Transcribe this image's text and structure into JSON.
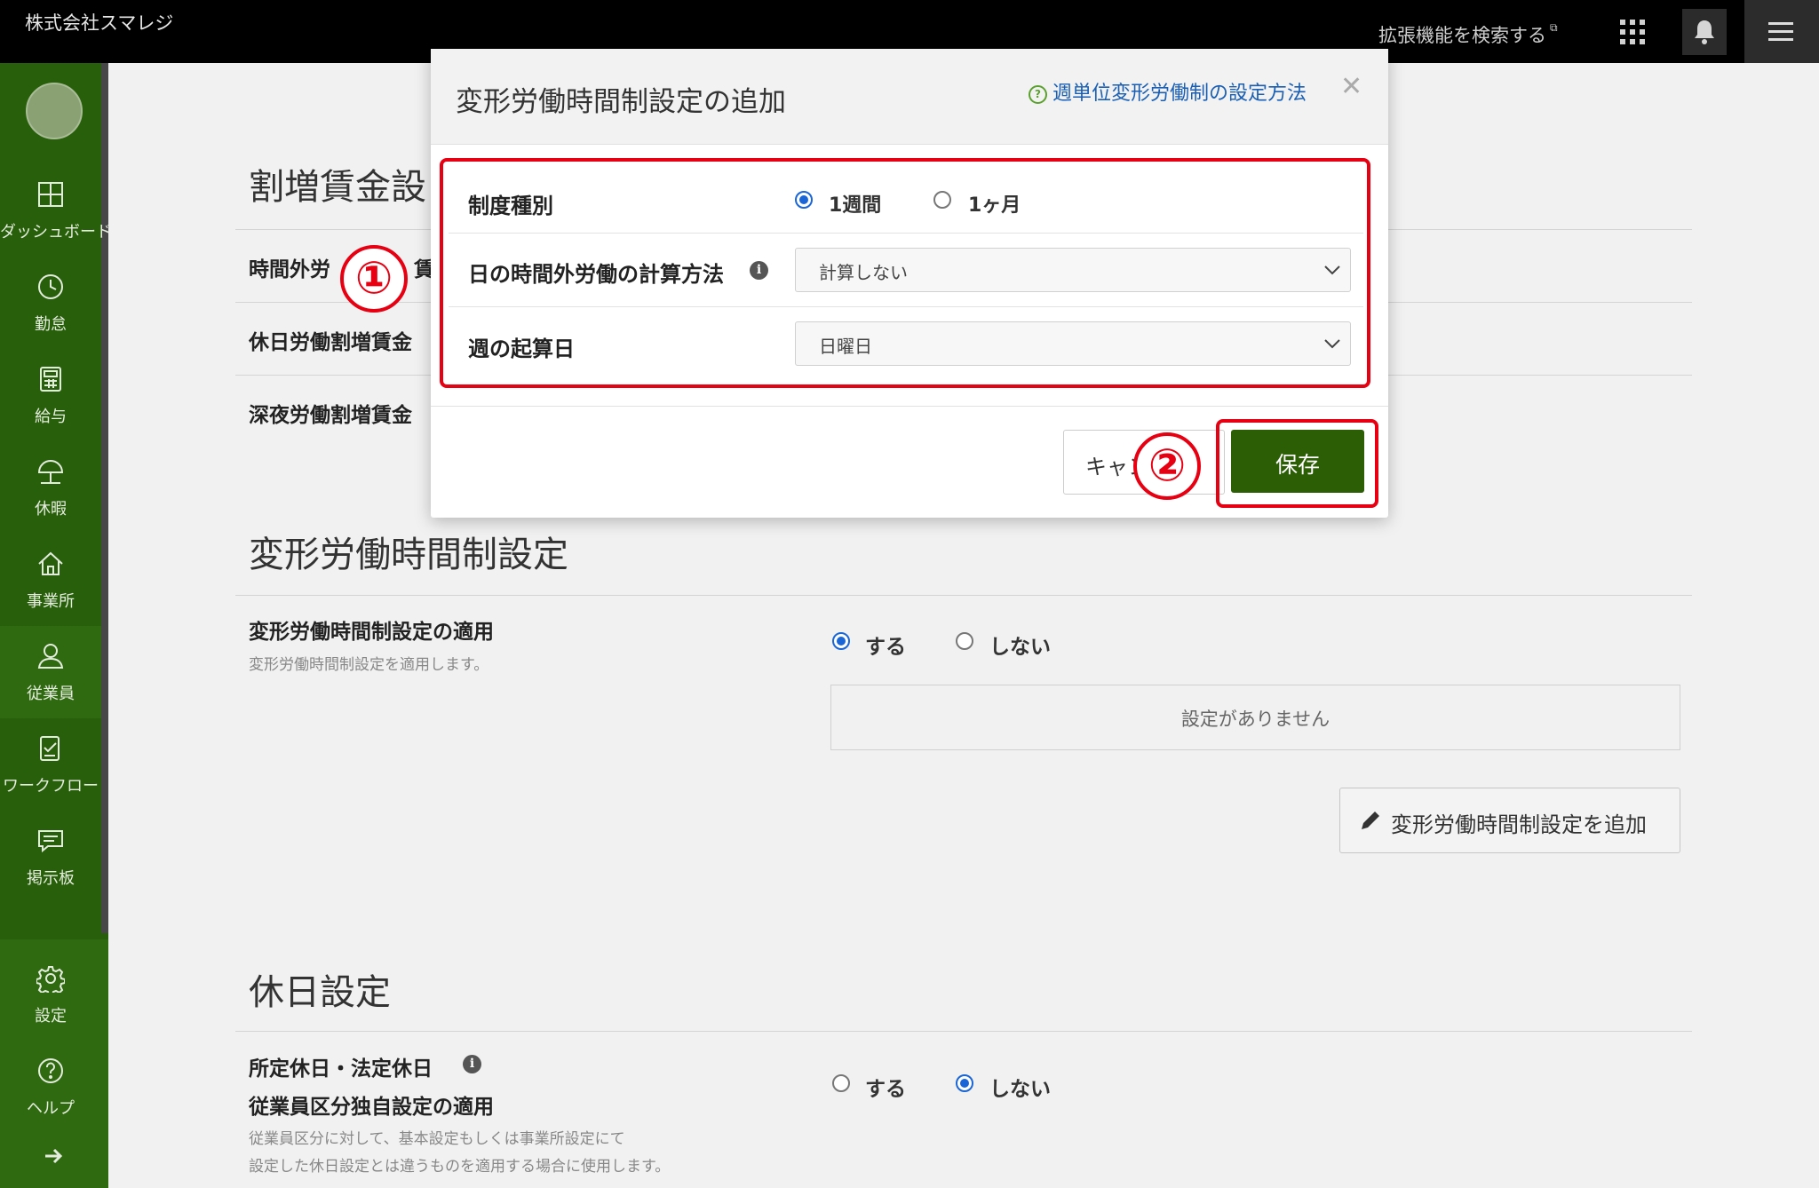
{
  "topbar": {
    "company": "株式会社スマレジ",
    "extensions_link": "拡張機能を検索する",
    "icons": [
      "external-link-icon",
      "apps-grid-icon",
      "bell-icon",
      "hamburger-menu-icon"
    ]
  },
  "sidebar": {
    "items": [
      {
        "label": "ダッシュボード",
        "icon": "dashboard-icon"
      },
      {
        "label": "勤怠",
        "icon": "clock-icon"
      },
      {
        "label": "給与",
        "icon": "calculator-icon"
      },
      {
        "label": "休暇",
        "icon": "umbrella-icon"
      },
      {
        "label": "事業所",
        "icon": "home-icon"
      },
      {
        "label": "従業員",
        "icon": "person-icon"
      },
      {
        "label": "ワークフロー",
        "icon": "workflow-icon"
      },
      {
        "label": "掲示板",
        "icon": "chat-icon"
      },
      {
        "label": "設定",
        "icon": "gear-icon"
      },
      {
        "label": "ヘルプ",
        "icon": "help-icon"
      }
    ]
  },
  "main": {
    "premium_section": {
      "title": "割増賃金設",
      "rows": [
        "時間外労",
        "休日労働割増賃金",
        "深夜労働割増賃金"
      ],
      "partial_char": "賃"
    },
    "flex_section": {
      "title": "変形労働時間制設定",
      "apply_label": "変形労働時間制設定の適用",
      "apply_desc": "変形労働時間制設定を適用します。",
      "option_yes": "する",
      "option_no": "しない",
      "selected": "する",
      "empty_text": "設定がありません",
      "add_button": "変形労働時間制設定を追加"
    },
    "holiday_section": {
      "title": "休日設定",
      "label_line1": "所定休日・法定休日",
      "label_line2": "従業員区分独自設定の適用",
      "desc_line1": "従業員区分に対して、基本設定もしくは事業所設定にて",
      "desc_line2": "設定した休日設定とは違うものを適用する場合に使用します。",
      "option_yes": "する",
      "option_no": "しない",
      "selected": "しない"
    }
  },
  "modal": {
    "title": "変形労働時間制設定の追加",
    "help_link": "週単位変形労働制の設定方法",
    "close": "✕",
    "rows": {
      "type_label": "制度種別",
      "type_option_week": "1週間",
      "type_option_month": "1ヶ月",
      "type_selected": "1週間",
      "daily_calc_label": "日の時間外労働の計算方法",
      "daily_calc_value": "計算しない",
      "week_start_label": "週の起算日",
      "week_start_value": "日曜日"
    },
    "cancel_button": "キャンセル",
    "save_button": "保存"
  },
  "annotations": {
    "step1": "①",
    "step2": "②",
    "color": "#e60012"
  },
  "colors": {
    "sidebar": "#285f0a",
    "save": "#2c5e05",
    "link": "#1a5fb4",
    "radio": "#1a66d6"
  }
}
